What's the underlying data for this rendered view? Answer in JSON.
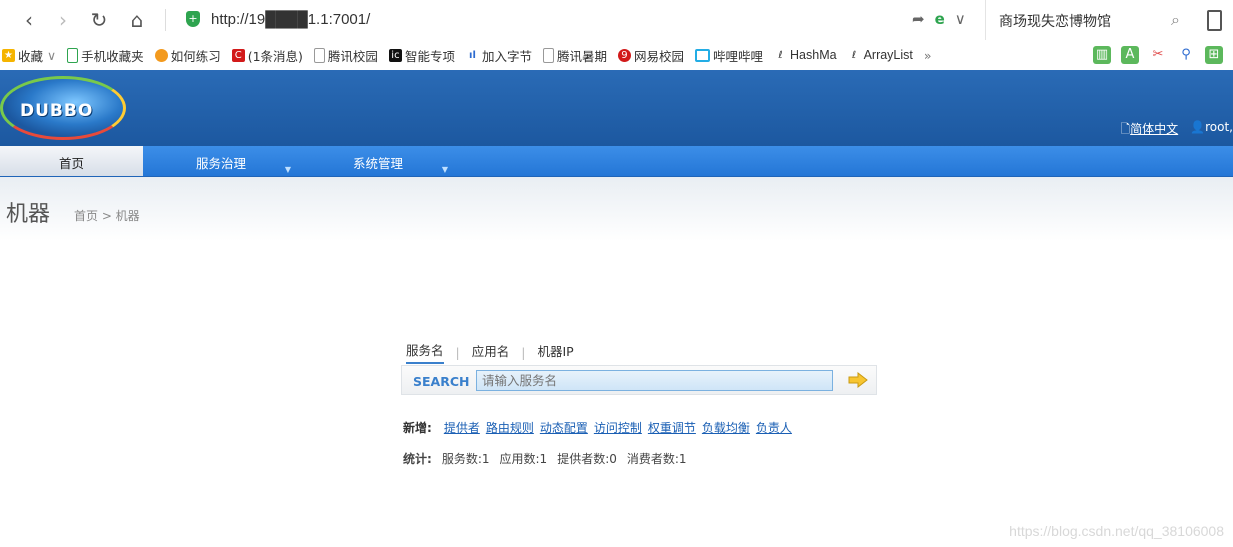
{
  "browser": {
    "url": "http://19████1.1:7001/",
    "search_text": "商场现失恋博物馆"
  },
  "bookmarks": [
    {
      "label": "收藏",
      "icon": "star-icon"
    },
    {
      "label": "手机收藏夹",
      "icon": "phone-icon"
    },
    {
      "label": "如何练习",
      "icon": "site-icon"
    },
    {
      "label": "(1条消息)",
      "icon": "csdn-icon"
    },
    {
      "label": "腾讯校园",
      "icon": "page-icon"
    },
    {
      "label": "智能专项",
      "icon": "site-icon"
    },
    {
      "label": "加入字节",
      "icon": "chart-icon"
    },
    {
      "label": "腾讯暑期",
      "icon": "page-icon"
    },
    {
      "label": "网易校园",
      "icon": "netease-icon"
    },
    {
      "label": "哔哩哔哩",
      "icon": "bilibili-icon"
    },
    {
      "label": "HashMa",
      "icon": "page-icon"
    },
    {
      "label": "ArrayList",
      "icon": "page-icon"
    }
  ],
  "header": {
    "logo_text": "DUBBO",
    "lang_link": "简体中文",
    "user": "root,"
  },
  "nav": {
    "tabs": [
      {
        "label": "首页",
        "active": true
      },
      {
        "label": "服务治理",
        "active": false
      },
      {
        "label": "系统管理",
        "active": false
      }
    ]
  },
  "page": {
    "title": "机器",
    "breadcrumb": "首页 > 机器"
  },
  "search": {
    "tabs": [
      "服务名",
      "应用名",
      "机器IP"
    ],
    "label": "SEARCH",
    "placeholder": "请输入服务名"
  },
  "add": {
    "label": "新增:",
    "links": [
      "提供者",
      "路由规则",
      "动态配置",
      "访问控制",
      "权重调节",
      "负载均衡",
      "负责人"
    ]
  },
  "stats": {
    "label": "统计:",
    "items": [
      "服务数:1",
      "应用数:1",
      "提供者数:0",
      "消费者数:1"
    ]
  },
  "watermark": "https://blog.csdn.net/qq_38106008"
}
